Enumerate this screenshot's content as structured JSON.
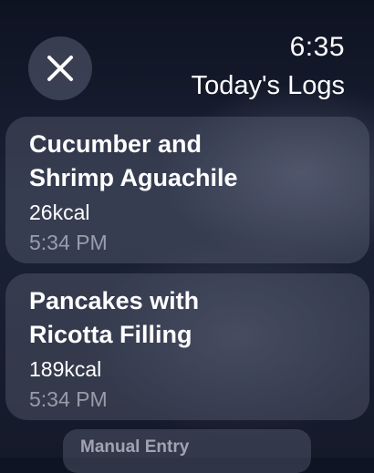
{
  "header": {
    "close_icon": "close-icon",
    "time": "6:35",
    "title": "Today's Logs"
  },
  "logs": [
    {
      "name_line1": "Cucumber and",
      "name_line2": "Shrimp Aguachile",
      "calories": "26kcal",
      "time": "5:34 PM"
    },
    {
      "name_line1": "Pancakes with",
      "name_line2": "Ricotta Filling",
      "calories": "189kcal",
      "time": "5:34 PM"
    }
  ],
  "footer": {
    "manual_entry_label": "Manual Entry"
  },
  "colors": {
    "background_top": "#0e1322",
    "card_fill": "#787d91",
    "secondary_text": "#ebebf5"
  }
}
